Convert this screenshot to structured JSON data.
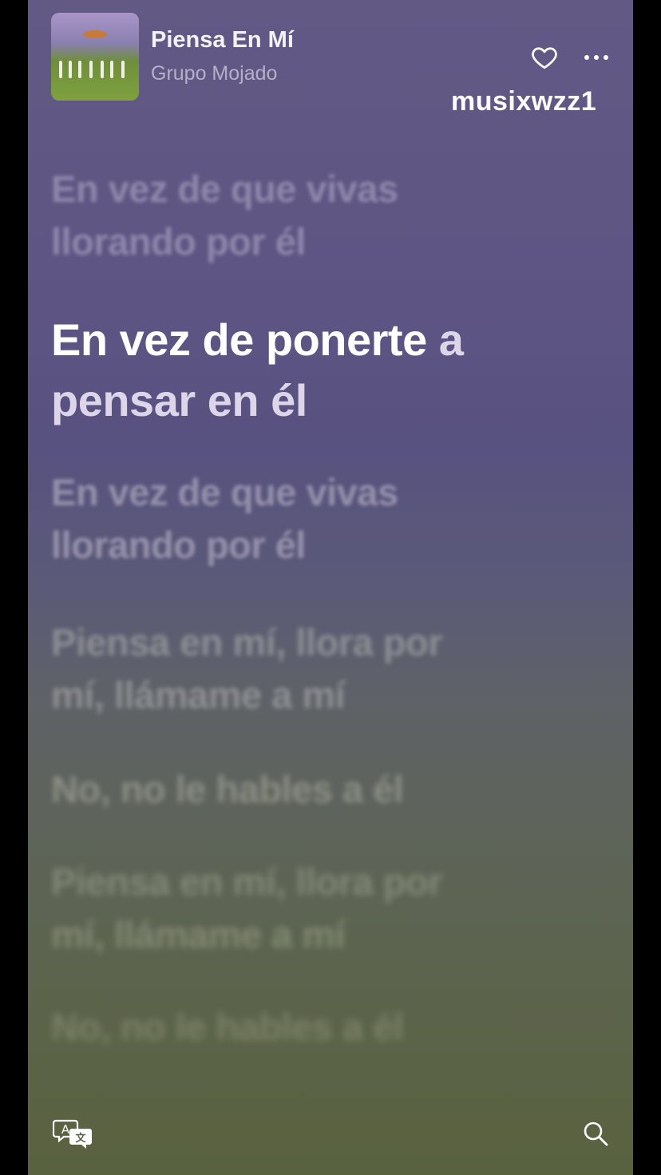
{
  "now_playing": {
    "title": "Piensa En Mí",
    "artist": "Grupo Mojado"
  },
  "watermark": "musixwzz1",
  "lyrics": [
    {
      "line1": "En vez de que vivas",
      "line2": "llorando por él"
    },
    {
      "line1_bright": "En vez de ponerte ",
      "line1_dim": "a",
      "line2": "pensar en él"
    },
    {
      "line1": "En vez de que vivas",
      "line2": "llorando por él"
    },
    {
      "line1": "Piensa en mí, llora por",
      "line2": "mí, llámame a mí"
    },
    {
      "line1": "No, no le hables a él"
    },
    {
      "line1": "Piensa en mí, llora por",
      "line2": "mí, llámame a mí"
    },
    {
      "line1": "No, no le hables a él"
    }
  ],
  "icons": {
    "favorite": "heart-icon",
    "more": "more-icon",
    "translate": "translate-icon",
    "search": "search-icon"
  }
}
